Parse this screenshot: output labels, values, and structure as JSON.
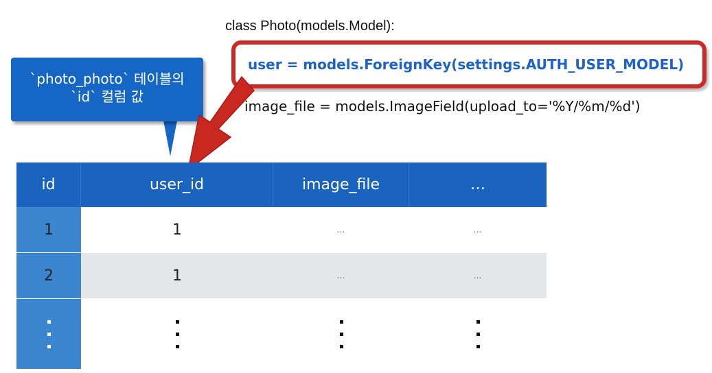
{
  "code": {
    "class_line": "class Photo(models.Model):",
    "highlight_line": "user = models.ForeignKey(settings.AUTH_USER_MODEL)",
    "image_line": "image_file = models.ImageField(upload_to='%Y/%m/%d')"
  },
  "callout": {
    "line1": "`photo_photo` 테이블의",
    "line2": "`id` 컬럼 값"
  },
  "table": {
    "headers": [
      "id",
      "user_id",
      "image_file",
      "…"
    ],
    "rows": [
      [
        "1",
        "1",
        "…",
        "…"
      ],
      [
        "2",
        "1",
        "…",
        "…"
      ]
    ]
  },
  "colors": {
    "header_blue": "#1a64bf",
    "id_column_blue": "#3c86cf",
    "highlight_red": "#cc2a24",
    "highlight_text_blue": "#1f63c6",
    "callout_blue": "#1667c5"
  }
}
